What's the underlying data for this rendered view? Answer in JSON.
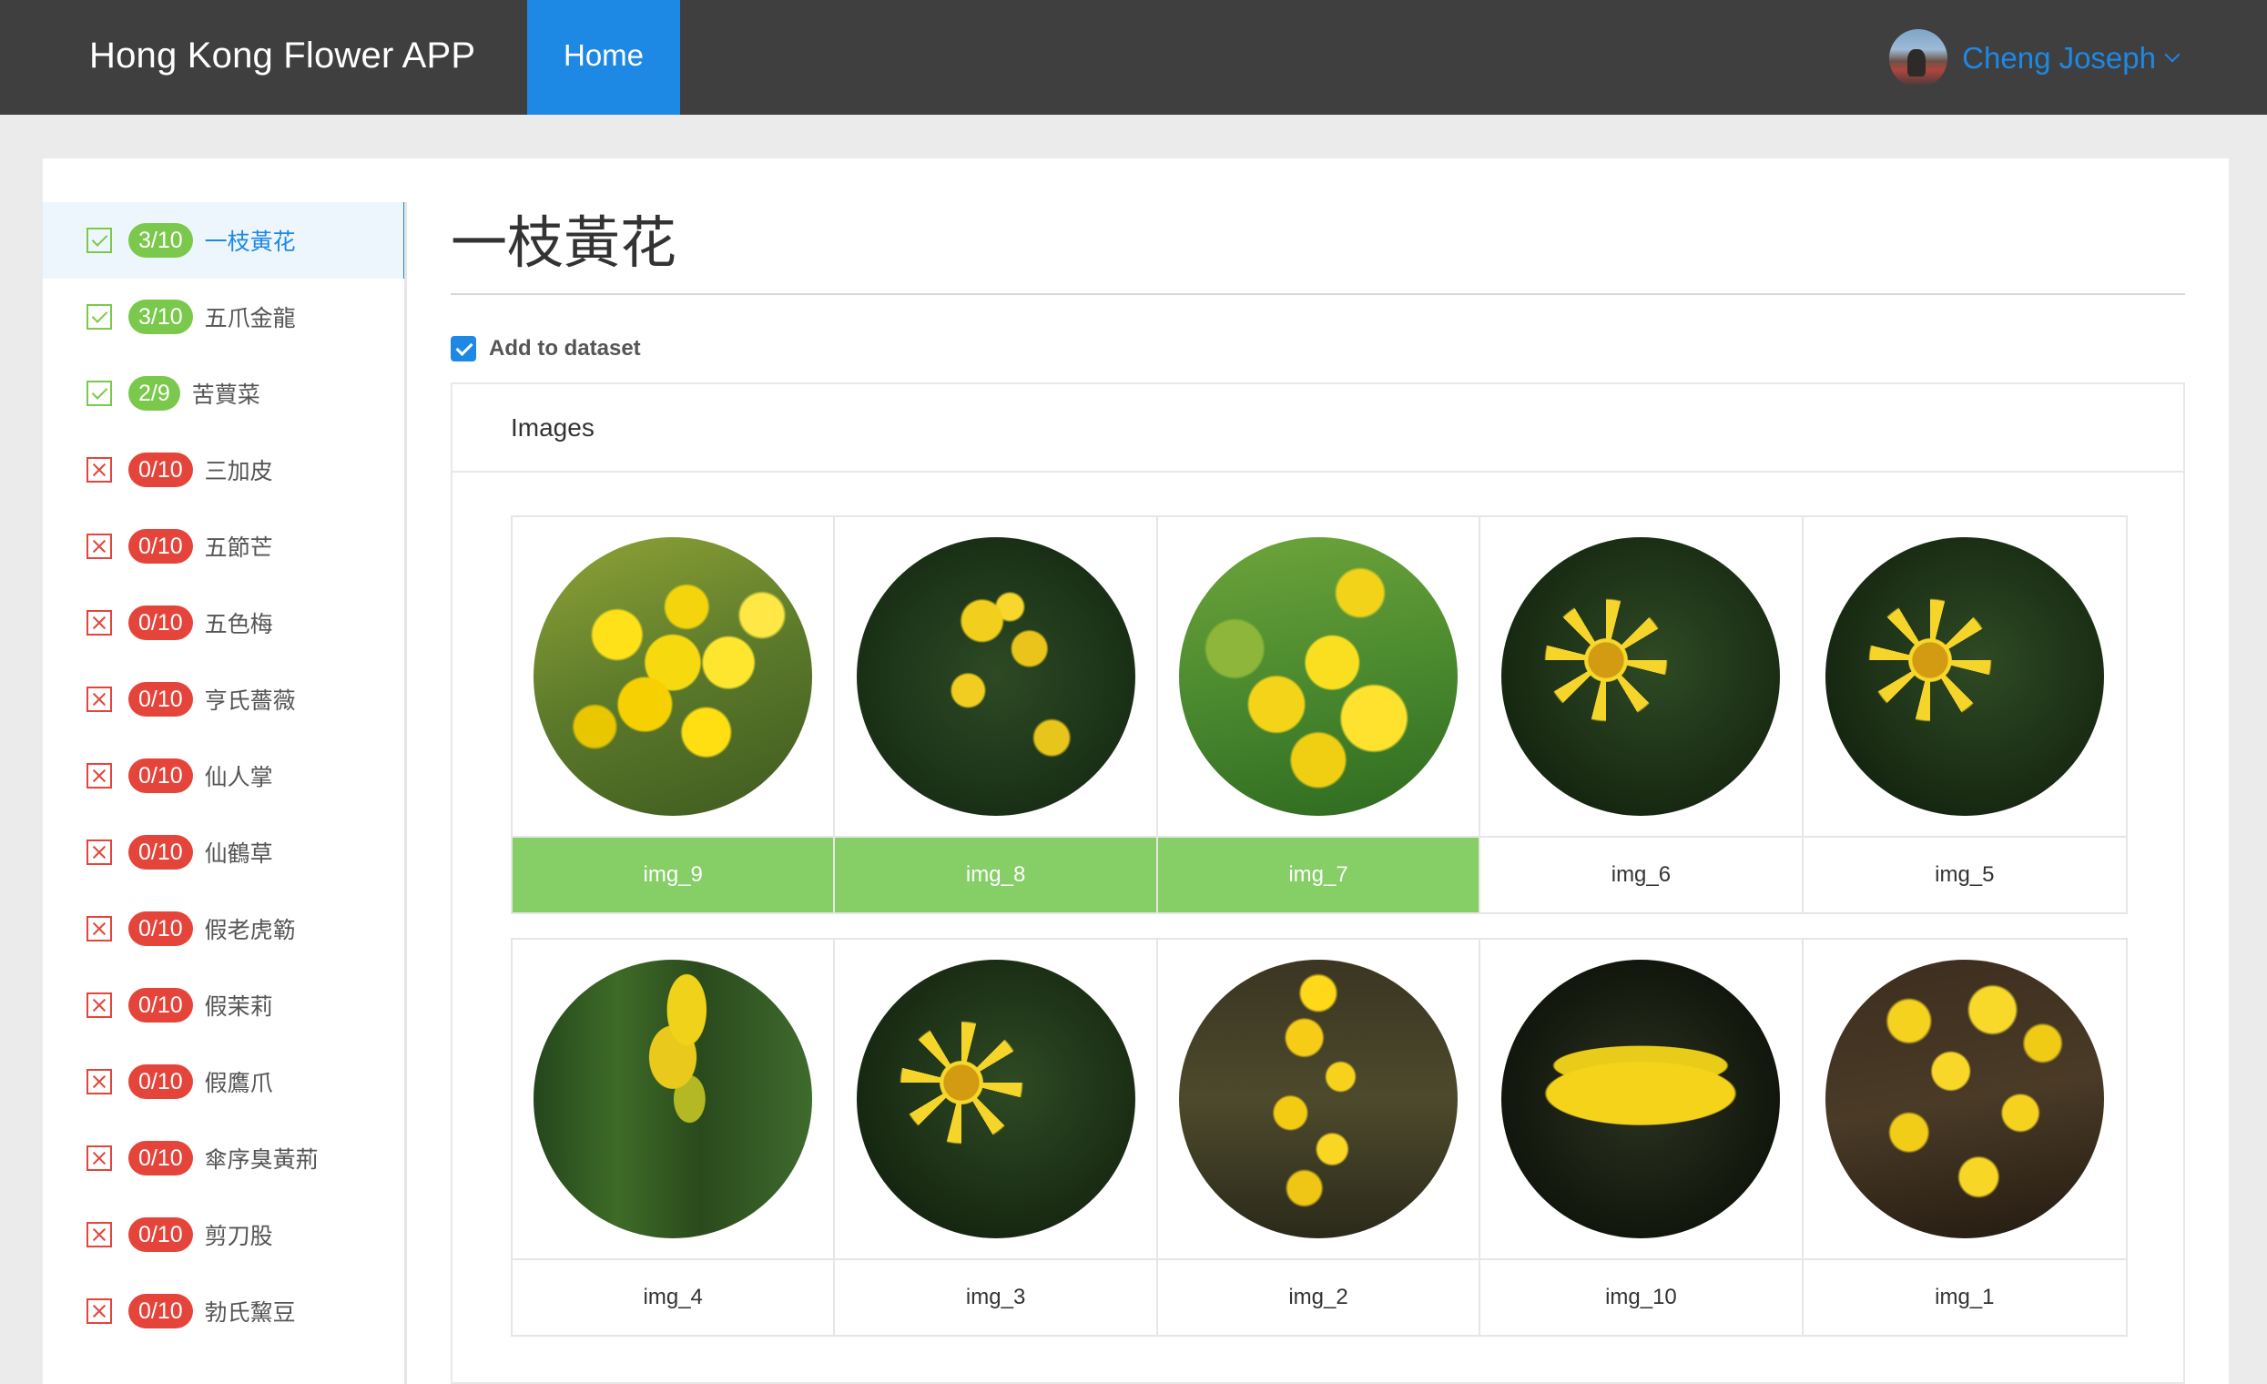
{
  "navbar": {
    "brand": "Hong Kong Flower APP",
    "home_label": "Home",
    "user_name": "Cheng Joseph"
  },
  "colors": {
    "navbar_bg": "#3f3f3f",
    "accent": "#1e88e5",
    "success": "#7bc94c",
    "danger": "#e5443b",
    "selected_caption": "#86ce66"
  },
  "sidebar": {
    "items": [
      {
        "status": "done",
        "count": "3/10",
        "label": "一枝黃花",
        "active": true
      },
      {
        "status": "done",
        "count": "3/10",
        "label": "五爪金龍"
      },
      {
        "status": "done",
        "count": "2/9",
        "label": "苦蕒菜"
      },
      {
        "status": "todo",
        "count": "0/10",
        "label": "三加皮"
      },
      {
        "status": "todo",
        "count": "0/10",
        "label": "五節芒"
      },
      {
        "status": "todo",
        "count": "0/10",
        "label": "五色梅"
      },
      {
        "status": "todo",
        "count": "0/10",
        "label": "亨氏薔薇"
      },
      {
        "status": "todo",
        "count": "0/10",
        "label": "仙人掌"
      },
      {
        "status": "todo",
        "count": "0/10",
        "label": "仙鶴草"
      },
      {
        "status": "todo",
        "count": "0/10",
        "label": "假老虎簕"
      },
      {
        "status": "todo",
        "count": "0/10",
        "label": "假茉莉"
      },
      {
        "status": "todo",
        "count": "0/10",
        "label": "假鷹爪"
      },
      {
        "status": "todo",
        "count": "0/10",
        "label": "傘序臭黃荊"
      },
      {
        "status": "todo",
        "count": "0/10",
        "label": "剪刀股"
      },
      {
        "status": "todo",
        "count": "0/10",
        "label": "勃氏黧豆"
      }
    ]
  },
  "main": {
    "title": "一枝黃花",
    "dataset_label": "Add to dataset",
    "dataset_checked": true,
    "images_heading": "Images",
    "images": [
      {
        "name": "img_9",
        "selected": true,
        "icon": "goldenrod-cluster-photo"
      },
      {
        "name": "img_8",
        "selected": true,
        "icon": "goldenrod-sparse-photo"
      },
      {
        "name": "img_7",
        "selected": true,
        "icon": "goldenrod-dense-photo"
      },
      {
        "name": "img_6",
        "selected": false,
        "icon": "yellow-star-flower-photo"
      },
      {
        "name": "img_5",
        "selected": false,
        "icon": "yellow-star-flower-photo"
      },
      {
        "name": "img_4",
        "selected": false,
        "icon": "goldenrod-spike-photo"
      },
      {
        "name": "img_3",
        "selected": false,
        "icon": "yellow-star-flower-photo"
      },
      {
        "name": "img_2",
        "selected": false,
        "icon": "goldenrod-tall-photo"
      },
      {
        "name": "img_10",
        "selected": false,
        "icon": "goldenrod-arc-photo"
      },
      {
        "name": "img_1",
        "selected": false,
        "icon": "goldenrod-many-photo"
      }
    ]
  }
}
